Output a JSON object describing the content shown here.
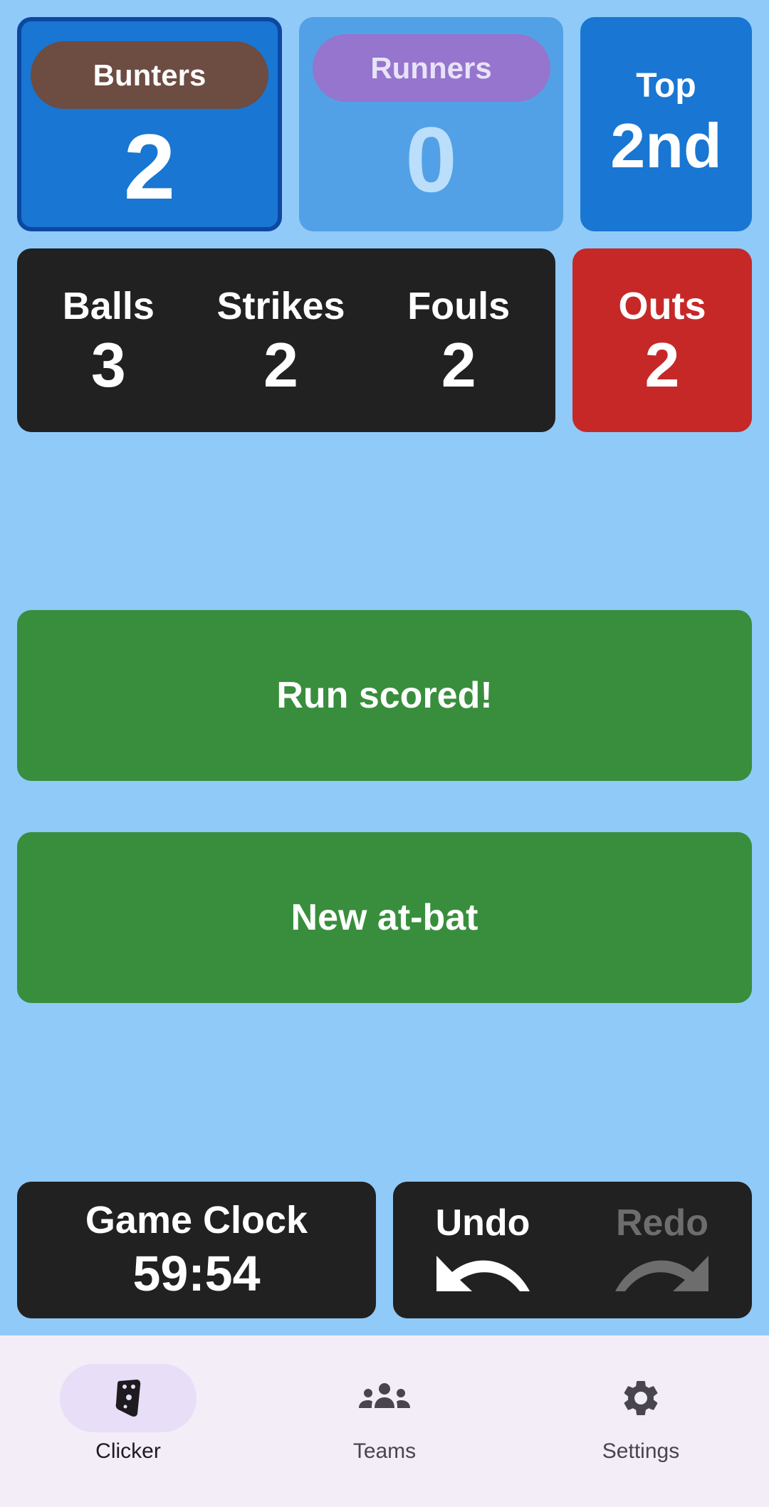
{
  "teams": {
    "home": {
      "name": "Bunters",
      "score": "2",
      "pill_color": "#6d4c41"
    },
    "away": {
      "name": "Runners",
      "score": "0",
      "pill_color": "#9575cd"
    }
  },
  "inning": {
    "half": "Top",
    "number": "2nd"
  },
  "count": {
    "balls_label": "Balls",
    "balls": "3",
    "strikes_label": "Strikes",
    "strikes": "2",
    "fouls_label": "Fouls",
    "fouls": "2"
  },
  "outs": {
    "label": "Outs",
    "value": "2"
  },
  "actions": {
    "run_scored": "Run scored!",
    "new_at_bat": "New at-bat"
  },
  "clock": {
    "label": "Game Clock",
    "value": "59:54"
  },
  "history": {
    "undo_label": "Undo",
    "redo_label": "Redo",
    "redo_enabled": false
  },
  "nav": {
    "items": [
      {
        "label": "Clicker",
        "icon": "clicker-icon",
        "active": true
      },
      {
        "label": "Teams",
        "icon": "groups-icon",
        "active": false
      },
      {
        "label": "Settings",
        "icon": "gear-icon",
        "active": false
      }
    ]
  },
  "colors": {
    "background": "#90caf9",
    "home_card": "#1976d2",
    "away_card": "#52a1e6",
    "panel": "#212121",
    "outs": "#c62828",
    "action": "#388e3c",
    "nav_bg": "#f3edf7"
  }
}
